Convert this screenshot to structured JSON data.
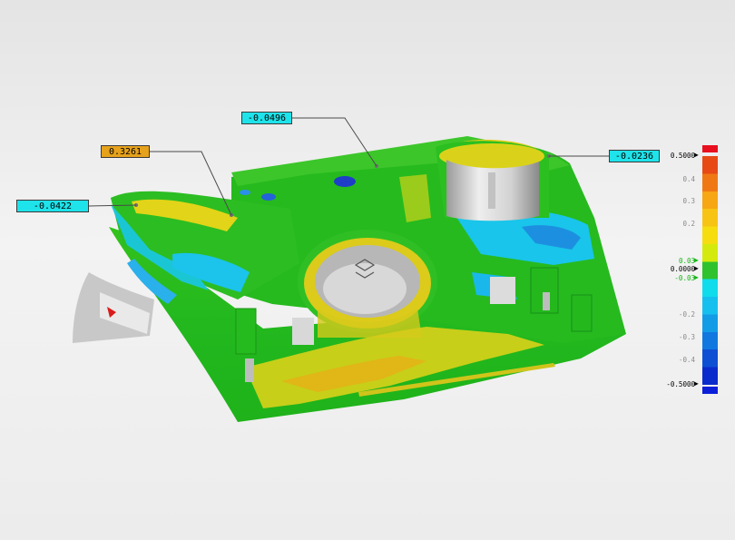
{
  "callouts": [
    {
      "value": "-0.0496",
      "color": "#1fe3ea"
    },
    {
      "value": "0.3261",
      "color": "#e6a21c"
    },
    {
      "value": "-0.0422",
      "color": "#1fe3ea"
    },
    {
      "value": "-0.0236",
      "color": "#1fe3ea"
    }
  ],
  "legend": {
    "max_label": "0.5000",
    "min_label": "-0.5000",
    "nominal_label": "0.0000",
    "upper_tol_label": "0.03",
    "lower_tol_label": "-0.03",
    "ticks": [
      "0.4",
      "0.3",
      "0.2",
      "-0.2",
      "-0.3",
      "-0.4"
    ],
    "over_color": "#e8101e",
    "under_color": "#0b1fd8",
    "in_tolerance_color": "#2ec22e",
    "band_colors": [
      "#e84a16",
      "#f07814",
      "#f7a614",
      "#f7c414",
      "#f5dd10",
      "#d4ea0c",
      "#2ec22e",
      "#10dcec",
      "#16c0ee",
      "#139ce6",
      "#1178e0",
      "#0d50d4",
      "#0a2ccc"
    ]
  }
}
